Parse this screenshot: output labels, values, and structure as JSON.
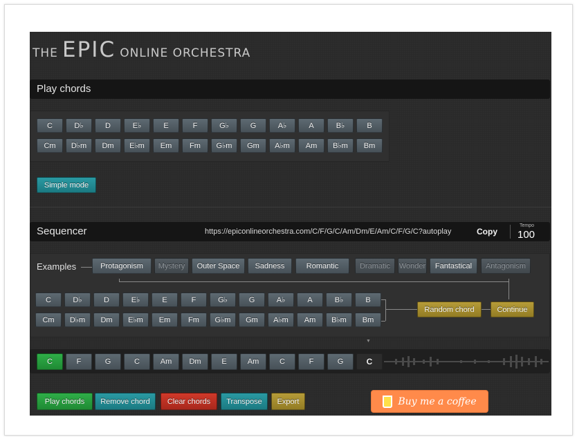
{
  "title": {
    "part1": "THE",
    "part2": "EPIC",
    "part3": "ONLINE ORCHESTRA"
  },
  "play_chords": {
    "heading": "Play chords"
  },
  "chords_major": [
    "C",
    "D♭",
    "D",
    "E♭",
    "E",
    "F",
    "G♭",
    "G",
    "A♭",
    "A",
    "B♭",
    "B"
  ],
  "chords_minor": [
    "Cm",
    "D♭m",
    "Dm",
    "E♭m",
    "Em",
    "Fm",
    "G♭m",
    "Gm",
    "A♭m",
    "Am",
    "B♭m",
    "Bm"
  ],
  "simple_mode": "Simple mode",
  "sequencer": {
    "heading": "Sequencer",
    "url": "https://epiconlineorchestra.com/C/F/G/C/Am/Dm/E/Am/C/F/G/C?autoplay",
    "copy": "Copy",
    "tempo_label": "Tempo",
    "tempo_value": "100"
  },
  "examples": {
    "label": "Examples",
    "items": [
      {
        "label": "Protagonism",
        "enabled": true
      },
      {
        "label": "Mystery",
        "enabled": false
      },
      {
        "label": "Outer Space",
        "enabled": true
      },
      {
        "label": "Sadness",
        "enabled": true
      },
      {
        "label": "Romantic",
        "enabled": true
      },
      {
        "label": "Dramatic",
        "enabled": false
      },
      {
        "label": "Wonder",
        "enabled": false
      },
      {
        "label": "Fantastical",
        "enabled": true
      },
      {
        "label": "Antagonism",
        "enabled": false
      }
    ]
  },
  "random_chord": "Random chord",
  "continue": "Continue",
  "sequence": [
    {
      "label": "C",
      "state": "active"
    },
    {
      "label": "F",
      "state": "normal"
    },
    {
      "label": "G",
      "state": "normal"
    },
    {
      "label": "C",
      "state": "normal"
    },
    {
      "label": "Am",
      "state": "normal"
    },
    {
      "label": "Dm",
      "state": "normal"
    },
    {
      "label": "E",
      "state": "normal"
    },
    {
      "label": "Am",
      "state": "normal"
    },
    {
      "label": "C",
      "state": "normal"
    },
    {
      "label": "F",
      "state": "normal"
    },
    {
      "label": "G",
      "state": "normal"
    },
    {
      "label": "C",
      "state": "empty"
    }
  ],
  "actions": {
    "play_chords": "Play chords",
    "remove_chord": "Remove chord",
    "clear_chords": "Clear chords",
    "transpose": "Transpose",
    "export": "Export"
  },
  "coffee": "Buy me a coffee",
  "colors": {
    "teal": "#1f8c94",
    "green": "#27a03e",
    "red": "#bc3022",
    "gold": "#a68a2c",
    "orange": "#ff8a4a"
  }
}
